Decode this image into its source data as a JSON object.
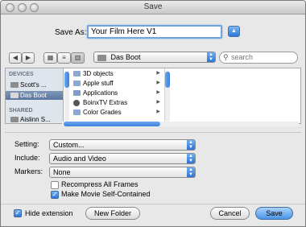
{
  "window": {
    "title": "Save"
  },
  "save_as": {
    "label": "Save As:",
    "value": "Your Film Here V1"
  },
  "location": {
    "selected": "Das Boot",
    "search_placeholder": "search"
  },
  "sidebar": {
    "devices_header": "DEVICES",
    "shared_header": "SHARED",
    "items": [
      {
        "label": "Scott's ...",
        "selected": false
      },
      {
        "label": "Das Boot",
        "selected": true
      },
      {
        "label": "Aislinn S...",
        "selected": false
      }
    ]
  },
  "files": [
    {
      "name": "3D objects",
      "icon": "folder-icon"
    },
    {
      "name": "Apple stuff",
      "icon": "folder-icon"
    },
    {
      "name": "Applications",
      "icon": "applications-folder-icon"
    },
    {
      "name": "BoinxTV Extras",
      "icon": "gear-icon"
    },
    {
      "name": "Color Grades",
      "icon": "folder-icon"
    }
  ],
  "options": {
    "setting": {
      "label": "Setting:",
      "value": "Custom..."
    },
    "include": {
      "label": "Include:",
      "value": "Audio and Video"
    },
    "markers": {
      "label": "Markers:",
      "value": "None"
    },
    "recompress": {
      "label": "Recompress All Frames",
      "checked": false
    },
    "self_contained": {
      "label": "Make Movie Self-Contained",
      "checked": true
    }
  },
  "footer": {
    "hide_extension": {
      "label": "Hide extension",
      "checked": true
    },
    "new_folder": "New Folder",
    "cancel": "Cancel",
    "save": "Save"
  },
  "colors": {
    "accent": "#3a82dc",
    "sidebar_bg": "#dfe5ed"
  }
}
